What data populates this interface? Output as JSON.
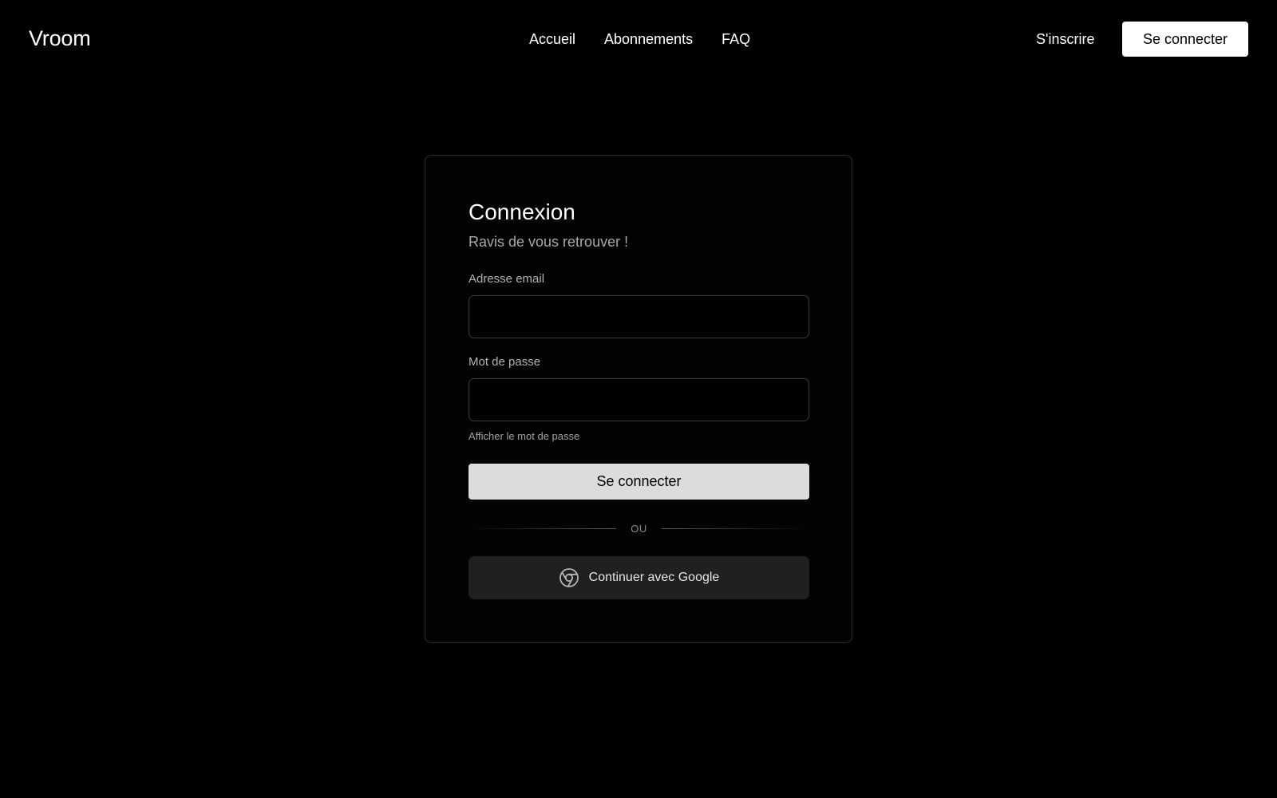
{
  "header": {
    "brand": "Vroom",
    "nav": [
      "Accueil",
      "Abonnements",
      "FAQ"
    ],
    "signup_label": "S'inscrire",
    "login_label": "Se connecter"
  },
  "login_card": {
    "title": "Connexion",
    "subtitle": "Ravis de vous retrouver !",
    "email_label": "Adresse email",
    "email_value": "",
    "password_label": "Mot de passe",
    "password_value": "",
    "show_password_label": "Afficher le mot de passe",
    "submit_label": "Se connecter",
    "divider_label": "OU",
    "google_label": "Continuer avec Google",
    "google_icon": "chrome-icon"
  },
  "colors": {
    "background": "#000000",
    "card_border": "#2e2e2e",
    "primary_button": "#dcdcdc",
    "google_button": "#202020",
    "muted_text": "#a8a8a8"
  }
}
